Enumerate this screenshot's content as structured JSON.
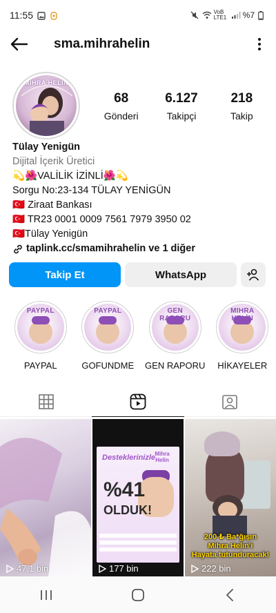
{
  "status_bar": {
    "time": "11:55",
    "network_label": "VoB LTE1",
    "battery": "%7"
  },
  "header": {
    "username": "sma.mihrahelin"
  },
  "profile": {
    "avatar_text": "MIHRA HELİN",
    "stats": [
      {
        "value": "68",
        "label": "Gönderi"
      },
      {
        "value": "6.127",
        "label": "Takipçi"
      },
      {
        "value": "218",
        "label": "Takip"
      }
    ],
    "bio": {
      "name": "Tülay Yenigün",
      "category": "Dijital İçerik Üretici",
      "line1": "💫🌺VALİLİK İZİNLİ🌺💫",
      "line2": "Sorgu No:23-134 TÜLAY YENİGÜN",
      "line3": "🇹🇷 Ziraat Bankası",
      "line4": "🇹🇷 TR23 0001 0009 7561 7979 3950 02",
      "line5": "🇹🇷Tülay Yenigün",
      "link": "taplink.cc/smamihrahelin ve 1 diğer"
    }
  },
  "actions": {
    "follow_label": "Takip Et",
    "whatsapp_label": "WhatsApp"
  },
  "highlights": [
    {
      "label": "PAYPAL",
      "cover_title": "PAYPAL"
    },
    {
      "label": "GOFUNDME",
      "cover_title": "PAYPAL"
    },
    {
      "label": "GEN RAPORU",
      "cover_title": "GEN RAPORU"
    },
    {
      "label": "HİKAYELER",
      "cover_title": "MIHRA HELİN"
    }
  ],
  "tabs": [
    "grid",
    "reels",
    "tagged"
  ],
  "posts": [
    {
      "views": "47,1 bin"
    },
    {
      "views": "177 bin",
      "headline": "Desteklerinizle",
      "brand": "Mihra Helin",
      "percent": "%41",
      "status": "OLDUK!"
    },
    {
      "views": "222 bin",
      "caption_line1": "200 ₺ Ba*ğışın",
      "caption_line2": "Mihra Helin'i",
      "caption_line3": "Hayata tutunduracak!"
    }
  ],
  "colors": {
    "accent": "#0095f6",
    "secondary_button": "#efefef",
    "muted_text": "#737373"
  }
}
